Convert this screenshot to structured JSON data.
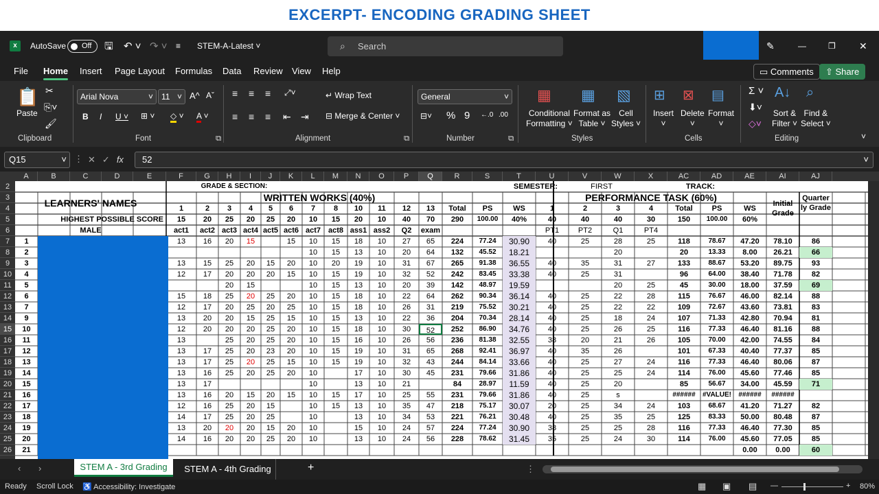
{
  "slide_title": "EXCERPT- ENCODING GRADING SHEET",
  "titlebar": {
    "autosave_label": "AutoSave",
    "autosave_state": "Off",
    "filename": "STEM-A-Latest",
    "search_placeholder": "Search",
    "window_min": "—",
    "window_max": "❐",
    "window_close": "✕"
  },
  "menu": {
    "items": [
      "File",
      "Home",
      "Insert",
      "Page Layout",
      "Formulas",
      "Data",
      "Review",
      "View",
      "Help"
    ],
    "comments": "Comments",
    "share": "Share"
  },
  "ribbon": {
    "clipboard": {
      "paste": "Paste",
      "group": "Clipboard"
    },
    "font": {
      "family": "Arial Nova",
      "size": "11",
      "group": "Font"
    },
    "alignment": {
      "wrap": "Wrap Text",
      "merge": "Merge & Center",
      "group": "Alignment"
    },
    "number": {
      "format": "General",
      "group": "Number"
    },
    "styles": {
      "conditional": "Conditional",
      "conditional2": "Formatting",
      "format_as": "Format as",
      "format_as2": "Table",
      "cell": "Cell",
      "cell2": "Styles",
      "group": "Styles"
    },
    "cells": {
      "insert": "Insert",
      "delete": "Delete",
      "format": "Format",
      "group": "Cells"
    },
    "editing": {
      "sort": "Sort &",
      "sort2": "Filter",
      "find": "Find &",
      "find2": "Select",
      "group": "Editing"
    }
  },
  "formula_bar": {
    "name_box": "Q15",
    "value": "52"
  },
  "columns": [
    "A",
    "B",
    "C",
    "D",
    "E",
    "F",
    "G",
    "H",
    "I",
    "J",
    "K",
    "L",
    "M",
    "N",
    "O",
    "P",
    "Q",
    "R",
    "S",
    "T",
    "U",
    "V",
    "W",
    "X",
    "AC",
    "AD",
    "AE",
    "AI",
    "AJ"
  ],
  "row_numbers": [
    "2",
    "3",
    "4",
    "5",
    "6",
    "7",
    "8",
    "9",
    "10",
    "11",
    "12",
    "13",
    "14",
    "15",
    "16",
    "17",
    "18",
    "19",
    "20",
    "21",
    "22",
    "23",
    "24",
    "25",
    "26"
  ],
  "sheet": {
    "grade_section": "GRADE & SECTION:",
    "semester_label": "SEMESTER:",
    "semester_value": "FIRST",
    "track_label": "TRACK:",
    "learners_names": "LEARNERS' NAMES",
    "written_works": "WRITTEN WORKS (40%)",
    "performance_task": "PERFORMANCE TASK (60%)",
    "initial_grade": "Initial Grade",
    "quarterly_grade": "Quarter ly Grade",
    "hps_label": "HIGHEST POSSIBLE SCORE",
    "male_label": "MALE",
    "ww_numbers": [
      "1",
      "2",
      "3",
      "4",
      "5",
      "6",
      "7",
      "8",
      "10",
      "11",
      "12",
      "13",
      "Total",
      "PS",
      "WS"
    ],
    "ww_hps": [
      "15",
      "20",
      "25",
      "20",
      "25",
      "20",
      "10",
      "15",
      "20",
      "10",
      "40",
      "70",
      "290",
      "100.00",
      "40%"
    ],
    "ww_names": [
      "act1",
      "act2",
      "act3",
      "act4",
      "act5",
      "act6",
      "act7",
      "act8",
      "ass1",
      "ass2",
      "Q2",
      "exam"
    ],
    "pt_numbers": [
      "1",
      "2",
      "3",
      "4",
      "Total",
      "PS",
      "WS"
    ],
    "pt_hps": [
      "40",
      "40",
      "40",
      "30",
      "150",
      "100.00",
      "60%"
    ],
    "pt_names": [
      "PT1",
      "PT2",
      "Q1",
      "PT4"
    ],
    "rows": [
      {
        "n": "1",
        "ww": [
          "13",
          "16",
          "20",
          "15",
          "",
          "15",
          "10",
          "15",
          "18",
          "10",
          "27",
          "65"
        ],
        "wt": "224",
        "wps": "77.24",
        "wws": "30.90",
        "pt": [
          "40",
          "25",
          "28",
          "25"
        ],
        "pt_t": "118",
        "pps": "78.67",
        "pws": "47.20",
        "ig": "78.10",
        "qg": "86"
      },
      {
        "n": "2",
        "ww": [
          "",
          "",
          "",
          "",
          "",
          "",
          "10",
          "15",
          "13",
          "10",
          "20",
          "64"
        ],
        "wt": "132",
        "wps": "45.52",
        "wws": "18.21",
        "pt": [
          "",
          "",
          "20",
          ""
        ],
        "pt_t": "20",
        "pps": "13.33",
        "pws": "8.00",
        "ig": "26.21",
        "qg": "66"
      },
      {
        "n": "3",
        "ww": [
          "13",
          "15",
          "25",
          "20",
          "15",
          "20",
          "10",
          "20",
          "19",
          "10",
          "31",
          "67"
        ],
        "wt": "265",
        "wps": "91.38",
        "wws": "36.55",
        "pt": [
          "40",
          "35",
          "31",
          "27"
        ],
        "pt_t": "133",
        "pps": "88.67",
        "pws": "53.20",
        "ig": "89.75",
        "qg": "93"
      },
      {
        "n": "4",
        "ww": [
          "12",
          "17",
          "20",
          "20",
          "20",
          "15",
          "10",
          "15",
          "19",
          "10",
          "32",
          "52"
        ],
        "wt": "242",
        "wps": "83.45",
        "wws": "33.38",
        "pt": [
          "40",
          "25",
          "31",
          ""
        ],
        "pt_t": "96",
        "pps": "64.00",
        "pws": "38.40",
        "ig": "71.78",
        "qg": "82"
      },
      {
        "n": "5",
        "ww": [
          "",
          "",
          "20",
          "15",
          "",
          "",
          "10",
          "15",
          "13",
          "10",
          "20",
          "39"
        ],
        "wt": "142",
        "wps": "48.97",
        "wws": "19.59",
        "pt": [
          "",
          "",
          "20",
          "25"
        ],
        "pt_t": "45",
        "pps": "30.00",
        "pws": "18.00",
        "ig": "37.59",
        "qg": "69"
      },
      {
        "n": "6",
        "ww": [
          "15",
          "18",
          "25",
          "20",
          "25",
          "20",
          "10",
          "15",
          "18",
          "10",
          "22",
          "64"
        ],
        "wt": "262",
        "wps": "90.34",
        "wws": "36.14",
        "pt": [
          "40",
          "25",
          "22",
          "28"
        ],
        "pt_t": "115",
        "pps": "76.67",
        "pws": "46.00",
        "ig": "82.14",
        "qg": "88"
      },
      {
        "n": "7",
        "ww": [
          "12",
          "17",
          "20",
          "25",
          "20",
          "25",
          "10",
          "15",
          "18",
          "10",
          "26",
          "31"
        ],
        "wt": "219",
        "wps": "75.52",
        "wws": "30.21",
        "pt": [
          "40",
          "25",
          "22",
          "22"
        ],
        "pt_t": "109",
        "pps": "72.67",
        "pws": "43.60",
        "ig": "73.81",
        "qg": "83"
      },
      {
        "n": "9",
        "ww": [
          "13",
          "20",
          "20",
          "15",
          "25",
          "15",
          "10",
          "15",
          "13",
          "10",
          "22",
          "36"
        ],
        "wt": "204",
        "wps": "70.34",
        "wws": "28.14",
        "pt": [
          "40",
          "25",
          "18",
          "24"
        ],
        "pt_t": "107",
        "pps": "71.33",
        "pws": "42.80",
        "ig": "70.94",
        "qg": "81"
      },
      {
        "n": "10",
        "ww": [
          "12",
          "20",
          "20",
          "20",
          "25",
          "20",
          "10",
          "15",
          "18",
          "10",
          "30",
          "52"
        ],
        "wt": "252",
        "wps": "86.90",
        "wws": "34.76",
        "pt": [
          "40",
          "25",
          "26",
          "25"
        ],
        "pt_t": "116",
        "pps": "77.33",
        "pws": "46.40",
        "ig": "81.16",
        "qg": "88"
      },
      {
        "n": "11",
        "ww": [
          "13",
          "",
          "25",
          "20",
          "25",
          "20",
          "10",
          "15",
          "16",
          "10",
          "26",
          "56"
        ],
        "wt": "236",
        "wps": "81.38",
        "wws": "32.55",
        "pt": [
          "38",
          "20",
          "21",
          "26"
        ],
        "pt_t": "105",
        "pps": "70.00",
        "pws": "42.00",
        "ig": "74.55",
        "qg": "84"
      },
      {
        "n": "12",
        "ww": [
          "13",
          "17",
          "25",
          "20",
          "23",
          "20",
          "10",
          "15",
          "19",
          "10",
          "31",
          "65"
        ],
        "wt": "268",
        "wps": "92.41",
        "wws": "36.97",
        "pt": [
          "40",
          "35",
          "26",
          ""
        ],
        "pt_t": "101",
        "pps": "67.33",
        "pws": "40.40",
        "ig": "77.37",
        "qg": "85"
      },
      {
        "n": "13",
        "ww": [
          "13",
          "17",
          "25",
          "20",
          "25",
          "15",
          "10",
          "15",
          "19",
          "10",
          "32",
          "43"
        ],
        "wt": "244",
        "wps": "84.14",
        "wws": "33.66",
        "pt": [
          "40",
          "25",
          "27",
          "24"
        ],
        "pt_t": "116",
        "pps": "77.33",
        "pws": "46.40",
        "ig": "80.06",
        "qg": "87"
      },
      {
        "n": "14",
        "ww": [
          "13",
          "16",
          "25",
          "20",
          "25",
          "20",
          "10",
          "",
          "17",
          "10",
          "30",
          "45"
        ],
        "wt": "231",
        "wps": "79.66",
        "wws": "31.86",
        "pt": [
          "40",
          "25",
          "25",
          "24"
        ],
        "pt_t": "114",
        "pps": "76.00",
        "pws": "45.60",
        "ig": "77.46",
        "qg": "85"
      },
      {
        "n": "15",
        "ww": [
          "13",
          "17",
          "",
          "",
          "",
          "",
          "10",
          "",
          "13",
          "10",
          "21",
          ""
        ],
        "wt": "84",
        "wps": "28.97",
        "wws": "11.59",
        "pt": [
          "40",
          "25",
          "20",
          ""
        ],
        "pt_t": "85",
        "pps": "56.67",
        "pws": "34.00",
        "ig": "45.59",
        "qg": "71"
      },
      {
        "n": "16",
        "ww": [
          "13",
          "16",
          "20",
          "15",
          "20",
          "15",
          "10",
          "15",
          "17",
          "10",
          "25",
          "55"
        ],
        "wt": "231",
        "wps": "79.66",
        "wws": "31.86",
        "pt": [
          "40",
          "25",
          "s",
          ""
        ],
        "pt_t": "######",
        "pps": "#VALUE!",
        "pws": "######",
        "ig": "######",
        "qg": ""
      },
      {
        "n": "17",
        "ww": [
          "12",
          "16",
          "25",
          "20",
          "15",
          "",
          "10",
          "15",
          "13",
          "10",
          "35",
          "47"
        ],
        "wt": "218",
        "wps": "75.17",
        "wws": "30.07",
        "pt": [
          "20",
          "25",
          "34",
          "24"
        ],
        "pt_t": "103",
        "pps": "68.67",
        "pws": "41.20",
        "ig": "71.27",
        "qg": "82"
      },
      {
        "n": "18",
        "ww": [
          "14",
          "17",
          "25",
          "20",
          "25",
          "",
          "10",
          "",
          "13",
          "10",
          "34",
          "53"
        ],
        "wt": "221",
        "wps": "76.21",
        "wws": "30.48",
        "pt": [
          "40",
          "25",
          "35",
          "25"
        ],
        "pt_t": "125",
        "pps": "83.33",
        "pws": "50.00",
        "ig": "80.48",
        "qg": "87"
      },
      {
        "n": "19",
        "ww": [
          "13",
          "20",
          "20",
          "20",
          "15",
          "20",
          "10",
          "",
          "15",
          "10",
          "24",
          "57"
        ],
        "wt": "224",
        "wps": "77.24",
        "wws": "30.90",
        "pt": [
          "38",
          "25",
          "25",
          "28"
        ],
        "pt_t": "116",
        "pps": "77.33",
        "pws": "46.40",
        "ig": "77.30",
        "qg": "85"
      },
      {
        "n": "20",
        "ww": [
          "14",
          "16",
          "20",
          "20",
          "25",
          "20",
          "10",
          "",
          "13",
          "10",
          "24",
          "56"
        ],
        "wt": "228",
        "wps": "78.62",
        "wws": "31.45",
        "pt": [
          "35",
          "25",
          "24",
          "30"
        ],
        "pt_t": "114",
        "pps": "76.00",
        "pws": "45.60",
        "ig": "77.05",
        "qg": "85"
      },
      {
        "n": "21",
        "ww": [
          "",
          "",
          "",
          "",
          "",
          "",
          "",
          "",
          "",
          "",
          "",
          ""
        ],
        "wt": "",
        "wps": "",
        "wws": "",
        "pt": [
          "",
          "",
          "",
          ""
        ],
        "pt_t": "",
        "pps": "",
        "pws": "0.00",
        "ig": "0.00",
        "qg": "60"
      }
    ]
  },
  "tabs": {
    "active": "STEM A - 3rd Grading",
    "other": "STEM A - 4th Grading",
    "add": "+"
  },
  "status": {
    "ready": "Ready",
    "scroll_lock": "Scroll Lock",
    "accessibility": "Accessibility: Investigate",
    "zoom": "80%"
  },
  "colors": {
    "accent": "#1866c0",
    "excel_green": "#107c41",
    "blue_block": "#0a6dd1",
    "highlight_purple": "#e4dff0",
    "highlight_green": "#c6efce"
  }
}
